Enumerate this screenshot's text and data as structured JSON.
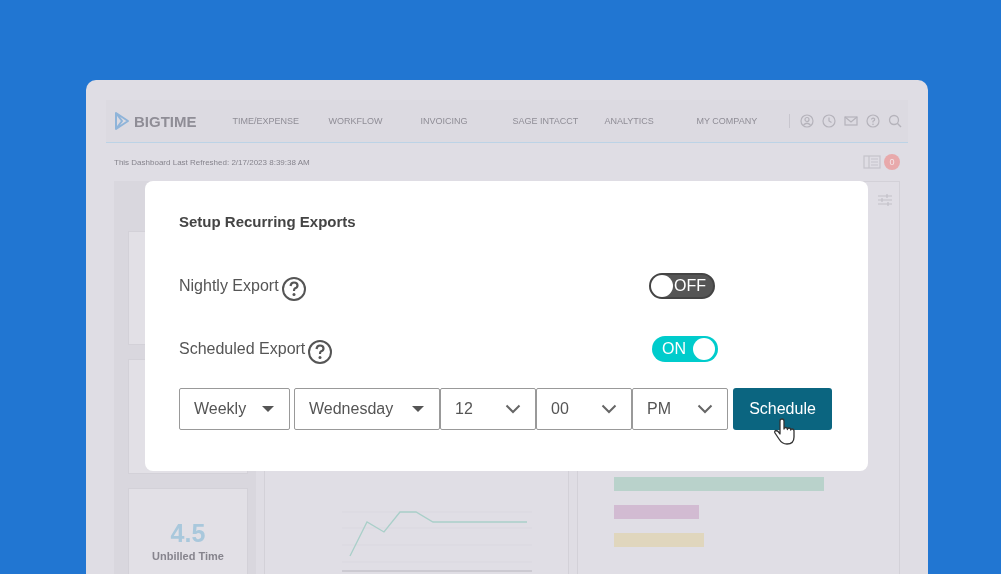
{
  "app": {
    "logo": "BIGTIME",
    "nav": [
      "TIME/EXPENSE",
      "WORKFLOW",
      "INVOICING",
      "SAGE INTACCT",
      "ANALYTICS",
      "MY COMPANY"
    ],
    "refreshed": "This Dashboard Last Refreshed: 2/17/2023 8:39:38 AM",
    "badge": "0",
    "metric": {
      "value": "4.5",
      "label": "Unbilled Time"
    }
  },
  "modal": {
    "title": "Setup Recurring Exports",
    "toggles": [
      {
        "label": "Nightly Export",
        "on": false,
        "text": "OFF"
      },
      {
        "label": "Scheduled Export",
        "on": true,
        "text": "ON"
      }
    ],
    "selects": [
      {
        "value": "Weekly",
        "kind": "caret"
      },
      {
        "value": "Wednesday",
        "kind": "caret"
      },
      {
        "value": "12",
        "kind": "chevron"
      },
      {
        "value": "00",
        "kind": "chevron"
      },
      {
        "value": "PM",
        "kind": "chevron"
      }
    ],
    "button": "Schedule"
  }
}
